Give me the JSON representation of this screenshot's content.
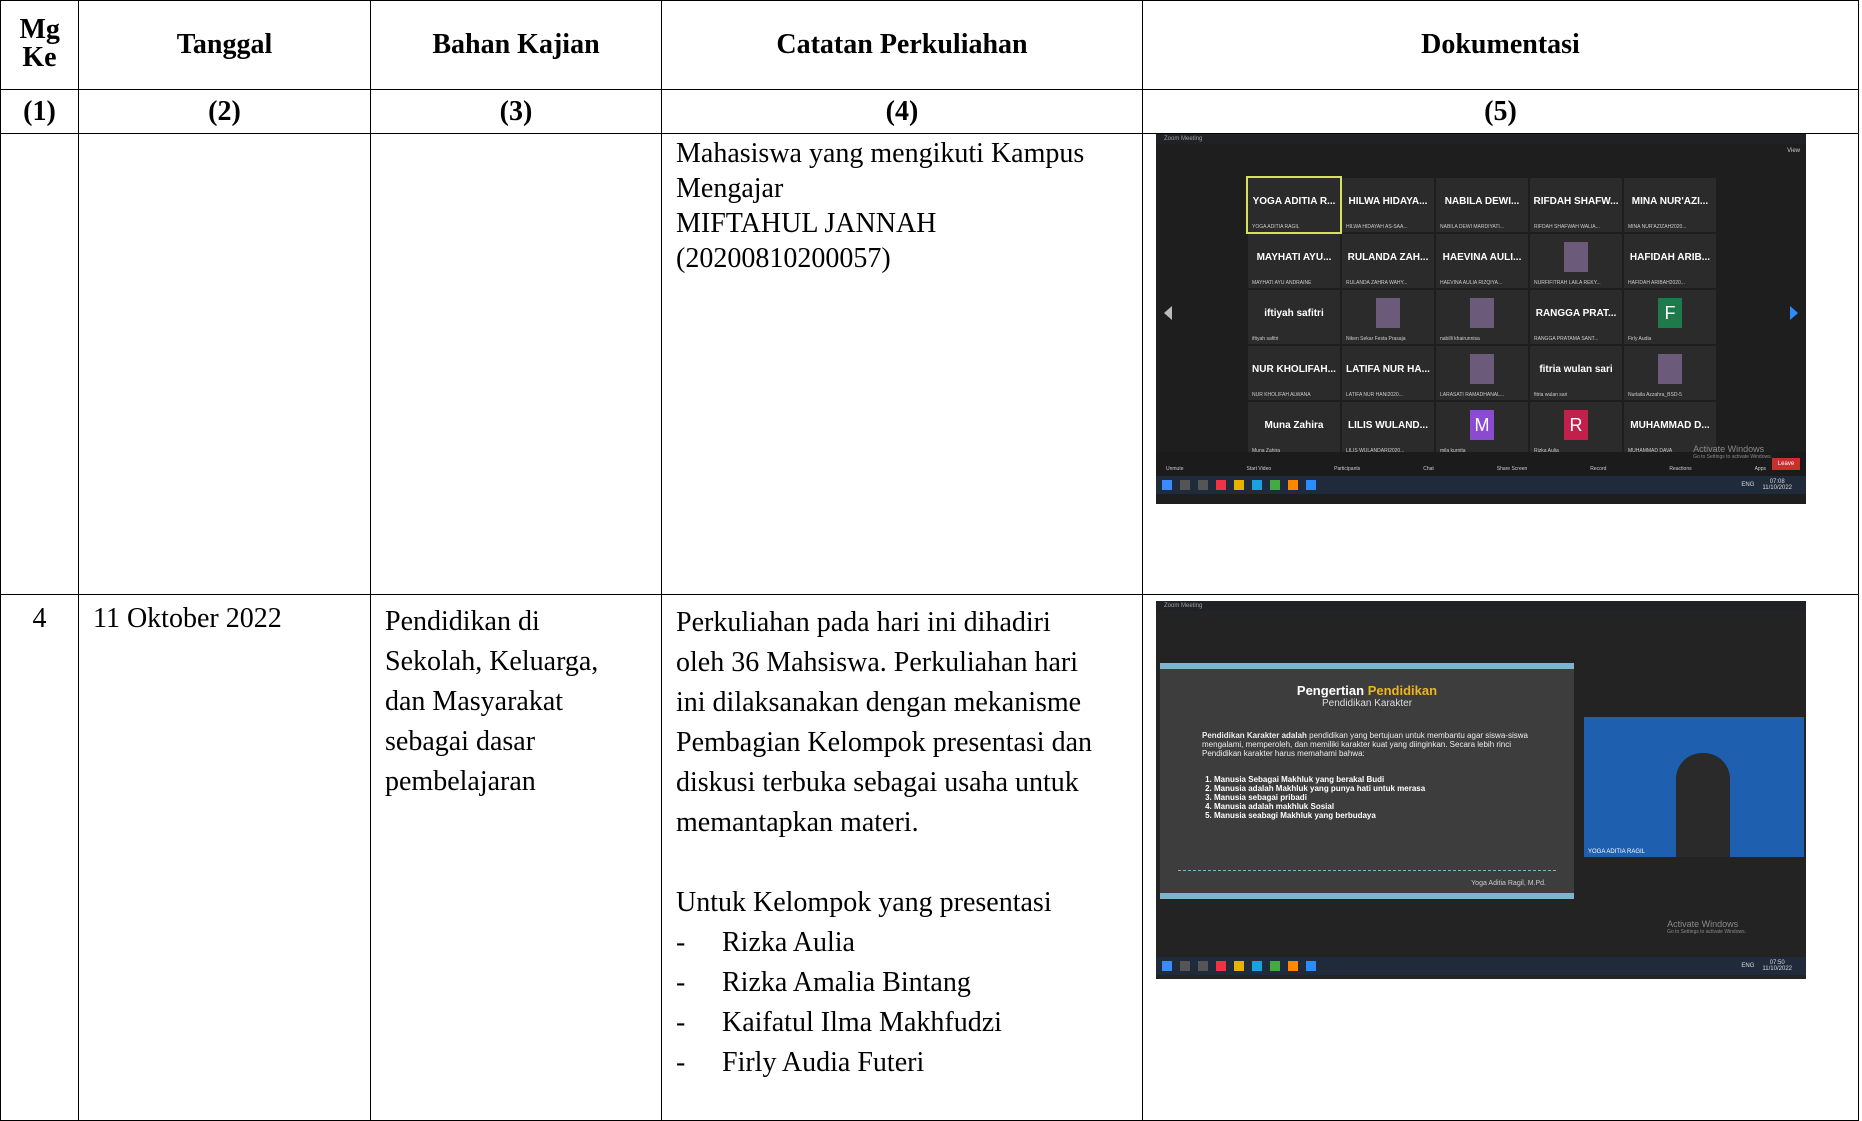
{
  "table": {
    "headers": [
      "Mg Ke",
      "Tanggal",
      "Bahan Kajian",
      "Catatan Perkuliahan",
      "Dokumentasi"
    ],
    "numbers": [
      "(1)",
      "(2)",
      "(3)",
      "(4)",
      "(5)"
    ]
  },
  "row1": {
    "notes": [
      "Mahasiswa yang mengikuti Kampus Mengajar",
      "MIFTAHUL JANNAH",
      "(20200810200057)"
    ],
    "shot": {
      "window_title": "Zoom Meeting",
      "view": "View",
      "tiles": [
        {
          "name": "YOGA ADITIA R...",
          "sub": "YOGA ADITIA RAGIL"
        },
        {
          "name": "HILWA HIDAYA...",
          "sub": "HILWA HIDAYAH AS-SAA..."
        },
        {
          "name": "NABILA DEWI...",
          "sub": "NABILA DEWI MARDIYATI..."
        },
        {
          "name": "RIFDAH SHAFW...",
          "sub": "RIFDAH SHAFWAH WALIA..."
        },
        {
          "name": "MINA NUR'AZI...",
          "sub": "MINA NUR'AZIZAH2020..."
        },
        {
          "name": "MAYHATI AYU...",
          "sub": "MAYHATI AYU ANDRAINE"
        },
        {
          "name": "RULANDA ZAH...",
          "sub": "RULANDA ZAHRA WAHY..."
        },
        {
          "name": "HAEVINA AULI...",
          "sub": "HAEVINA AULIA RIZQIYA..."
        },
        {
          "name": "",
          "sub": "NURFIFITRAH LAILA REKY..."
        },
        {
          "name": "HAFIDAH ARIB...",
          "sub": "HAFIDAH ARIBAH2020..."
        },
        {
          "name": "iftiyah safitri",
          "sub": "iftiyah safitri"
        },
        {
          "name": "",
          "sub": "Niken Sekar Festa Prasaja"
        },
        {
          "name": "",
          "sub": "nabilli khairunnisa"
        },
        {
          "name": "RANGGA PRAT...",
          "sub": "RANGGA PRATAMA SANT..."
        },
        {
          "name": "F",
          "sub": "Firly Audia"
        },
        {
          "name": "NUR KHOLIFAH...",
          "sub": "NUR KHOLIFAH ALWANA"
        },
        {
          "name": "LATIFA NUR HA...",
          "sub": "LATIFA NUR HANI2020..."
        },
        {
          "name": "",
          "sub": "LARASATI RAMADHANAL..."
        },
        {
          "name": "fitria wulan sari",
          "sub": "fitria wulan sari"
        },
        {
          "name": "",
          "sub": "Nurlaila Azzahra_BSD-5"
        },
        {
          "name": "Muna Zahira",
          "sub": "Muna Zahira"
        },
        {
          "name": "LILIS WULAND...",
          "sub": "LILIS WULANDARI2020..."
        },
        {
          "name": "M",
          "sub": "mila kurnita"
        },
        {
          "name": "R",
          "sub": "Rizka Aulia"
        },
        {
          "name": "MUHAMMAD D...",
          "sub": "MUHAMMAD DAVA"
        }
      ],
      "controls": [
        "Unmute",
        "Start Video",
        "Participants",
        "Chat",
        "Share Screen",
        "Record",
        "Reactions",
        "Apps"
      ],
      "participants_count": "51",
      "leave": "Leave",
      "activate_title": "Activate Windows",
      "activate_sub": "Go to Settings to activate Windows.",
      "tray": "ENG",
      "clock_time": "07:08",
      "clock_date": "11/10/2022"
    }
  },
  "row2": {
    "mg": "4",
    "tanggal": "11 Oktober 2022",
    "bahan": [
      "Pendidikan di",
      "Sekolah, Keluarga,",
      "dan Masyarakat",
      "sebagai dasar",
      "pembelajaran"
    ],
    "notes": [
      "Perkuliahan pada hari ini dihadiri",
      "oleh 36 Mahsiswa. Perkuliahan hari",
      "ini dilaksanakan dengan mekanisme",
      "Pembagian Kelompok presentasi dan",
      "diskusi terbuka sebagai usaha untuk",
      "memantapkan materi."
    ],
    "group_intro": "Untuk Kelompok yang presentasi",
    "groups": [
      "Rizka Aulia",
      "Rizka Amalia Bintang",
      "Kaifatul Ilma Makhfudzi",
      "Firly Audia Futeri"
    ],
    "dash": "-",
    "shot": {
      "window_title": "Zoom Meeting",
      "slide_title_a": "Pengertian",
      "slide_title_b": "Pendidikan",
      "slide_subtitle": "Pendidikan Karakter",
      "slide_para_bold": "Pendidikan Karakter adalah",
      "slide_para": " pendidikan yang bertujuan untuk membantu agar siswa-siswa mengalami, memperoleh, dan memiliki karakter kuat yang diinginkan. Secara lebih rinci Pendidikan karakter harus memahami bahwa:",
      "slide_list": [
        "Manusia Sebagai Makhluk yang berakal Budi",
        "Manusia adalah Makhluk yang punya hati untuk merasa",
        "Manusia sebagai pribadi",
        "Manusia adalah makhluk Sosial",
        "Manusia seabagi Makhluk yang berbudaya"
      ],
      "slide_sig": "Yoga Aditia Ragil, M.Pd.",
      "cam_label": "YOGA ADITIA RAGIL",
      "activate_title": "Activate Windows",
      "activate_sub": "Go to Settings to activate Windows.",
      "tray": "ENG",
      "clock_time": "07:50",
      "clock_date": "11/10/2022"
    }
  },
  "colors": {
    "border": "#000000",
    "zoom_bg": "#1e1e1e",
    "slide_accent": "#7fb4cf",
    "highlight": "#f0b323",
    "leave": "#c9302c"
  }
}
